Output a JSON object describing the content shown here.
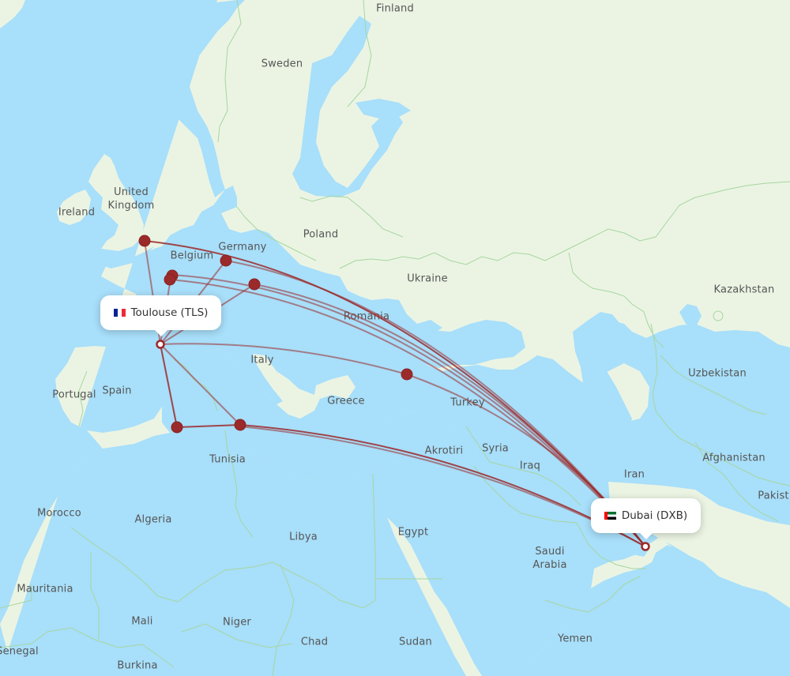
{
  "map": {
    "colors": {
      "water": "#a8dffa",
      "land": "#ebf4e3",
      "border": "#a6d6a0",
      "route": "#9b2a2a",
      "label": "#555555"
    },
    "country_labels": [
      {
        "id": "finland",
        "text": "Finland"
      },
      {
        "id": "sweden",
        "text": "Sweden"
      },
      {
        "id": "united-kingdom",
        "text": "United\nKingdom"
      },
      {
        "id": "ireland",
        "text": "Ireland"
      },
      {
        "id": "poland",
        "text": "Poland"
      },
      {
        "id": "germany",
        "text": "Germany"
      },
      {
        "id": "belgium",
        "text": "Belgium"
      },
      {
        "id": "ukraine",
        "text": "Ukraine"
      },
      {
        "id": "kazakhstan",
        "text": "Kazakhstan"
      },
      {
        "id": "romania",
        "text": "Romania"
      },
      {
        "id": "italy",
        "text": "Italy"
      },
      {
        "id": "uzbekistan",
        "text": "Uzbekistan"
      },
      {
        "id": "portugal",
        "text": "Portugal"
      },
      {
        "id": "spain",
        "text": "Spain"
      },
      {
        "id": "greece",
        "text": "Greece"
      },
      {
        "id": "turkey",
        "text": "Turkey"
      },
      {
        "id": "tunisia",
        "text": "Tunisia"
      },
      {
        "id": "akrotiri",
        "text": "Akrotiri"
      },
      {
        "id": "syria",
        "text": "Syria"
      },
      {
        "id": "afghanistan",
        "text": "Afghanistan"
      },
      {
        "id": "iraq",
        "text": "Iraq"
      },
      {
        "id": "iran",
        "text": "Iran"
      },
      {
        "id": "pakistan",
        "text": "Pakist"
      },
      {
        "id": "morocco",
        "text": "Morocco"
      },
      {
        "id": "algeria",
        "text": "Algeria"
      },
      {
        "id": "libya",
        "text": "Libya"
      },
      {
        "id": "egypt",
        "text": "Egypt"
      },
      {
        "id": "saudi-arabia",
        "text": "Saudi\nArabia"
      },
      {
        "id": "mauritania",
        "text": "Mauritania"
      },
      {
        "id": "mali",
        "text": "Mali"
      },
      {
        "id": "niger",
        "text": "Niger"
      },
      {
        "id": "yemen",
        "text": "Yemen"
      },
      {
        "id": "chad",
        "text": "Chad"
      },
      {
        "id": "sudan",
        "text": "Sudan"
      },
      {
        "id": "senegal",
        "text": "Senegal"
      },
      {
        "id": "burkina",
        "text": "Burkina"
      }
    ],
    "origin": {
      "city": "Toulouse",
      "code": "TLS",
      "label": "Toulouse (TLS)",
      "flag": "flag-france-icon"
    },
    "destination": {
      "city": "Dubai",
      "code": "DXB",
      "label": "Dubai (DXB)",
      "flag": "flag-uae-icon"
    },
    "stopovers": [
      {
        "id": "london"
      },
      {
        "id": "frankfurt"
      },
      {
        "id": "paris-a"
      },
      {
        "id": "paris-b"
      },
      {
        "id": "munich"
      },
      {
        "id": "istanbul"
      },
      {
        "id": "algiers"
      },
      {
        "id": "tunis"
      }
    ]
  }
}
